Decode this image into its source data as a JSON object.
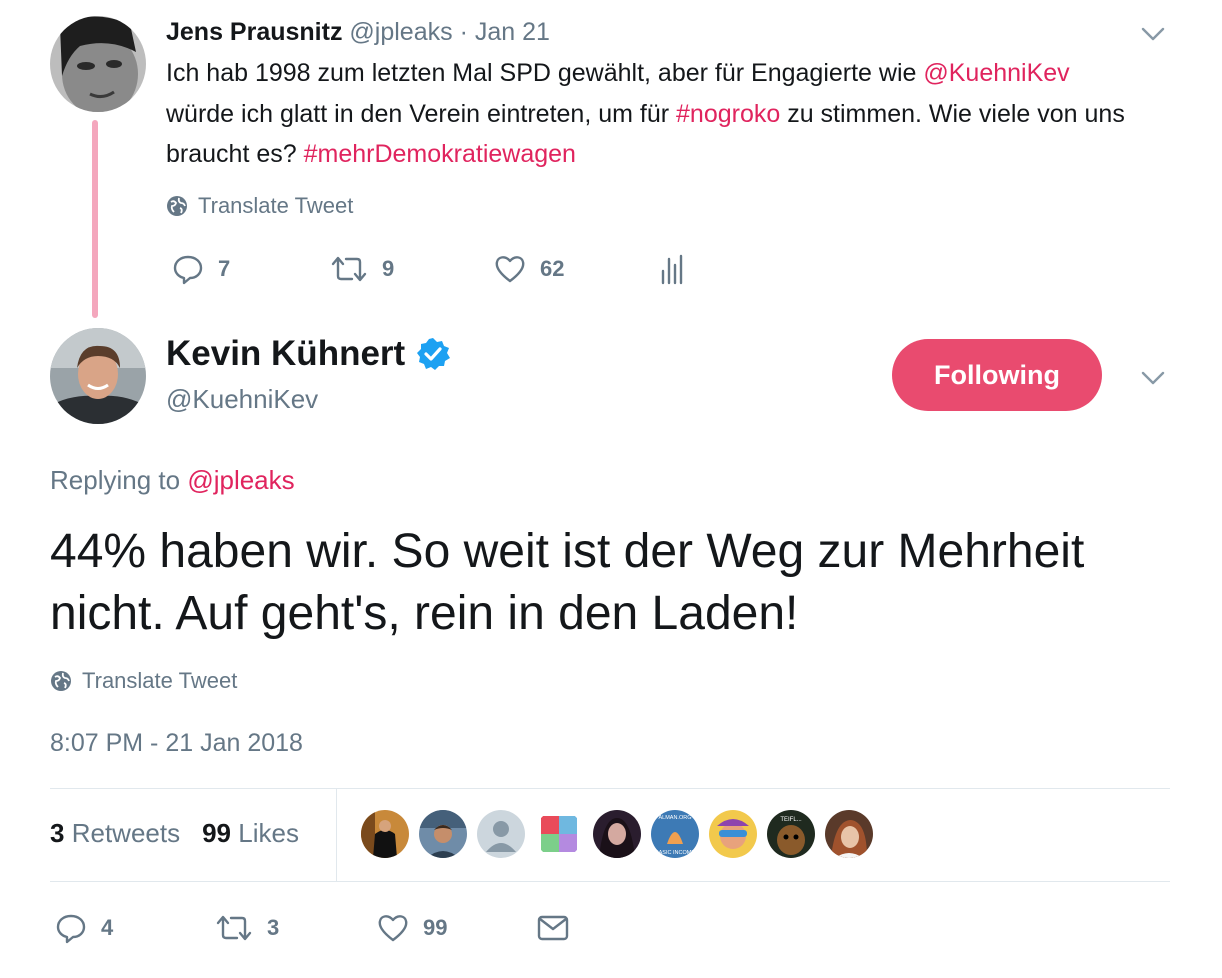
{
  "parent_tweet": {
    "name": "Jens Prausnitz",
    "handle": "@jpleaks",
    "separator": "·",
    "date": "Jan 21",
    "text_1": "Ich hab 1998 zum letzten Mal SPD gewählt, aber für Engagierte wie ",
    "mention": "@KuehniKev",
    "text_2": " würde ich glatt in den Verein eintreten, um für ",
    "hashtag_1": "#nogroko",
    "text_3": " zu stimmen. Wie viele von uns braucht es? ",
    "hashtag_2": "#mehrDemokratiewagen",
    "translate_label": "Translate Tweet",
    "replies": "7",
    "retweets": "9",
    "likes": "62"
  },
  "main_tweet": {
    "name": "Kevin Kühnert",
    "verified": true,
    "handle": "@KuehniKev",
    "follow_label": "Following",
    "replying_prefix": "Replying to ",
    "replying_handle": "@jpleaks",
    "text": "44% haben wir. So weit ist der Weg zur Mehrheit nicht. Auf geht's, rein in den Laden!",
    "translate_label": "Translate Tweet",
    "timestamp": "8:07 PM - 21 Jan 2018",
    "retweet_count": "3",
    "retweet_label": "Retweets",
    "like_count": "99",
    "like_label": "Likes",
    "liker_avatars": [
      "avatar-1",
      "avatar-2",
      "avatar-3",
      "avatar-4",
      "avatar-5",
      "avatar-6",
      "avatar-7",
      "avatar-8",
      "avatar-9"
    ],
    "liker_avatar_texts": [
      "ALMAN.ORG",
      "BASIC INCOME",
      "TEIFL..."
    ],
    "replies": "4",
    "retweets": "3",
    "likes": "99"
  },
  "colors": {
    "accent": "#e0245e",
    "follow_button": "#e94b6f",
    "muted": "#657786",
    "thread_line": "#f4a7bd",
    "verified": "#1da1f2"
  }
}
